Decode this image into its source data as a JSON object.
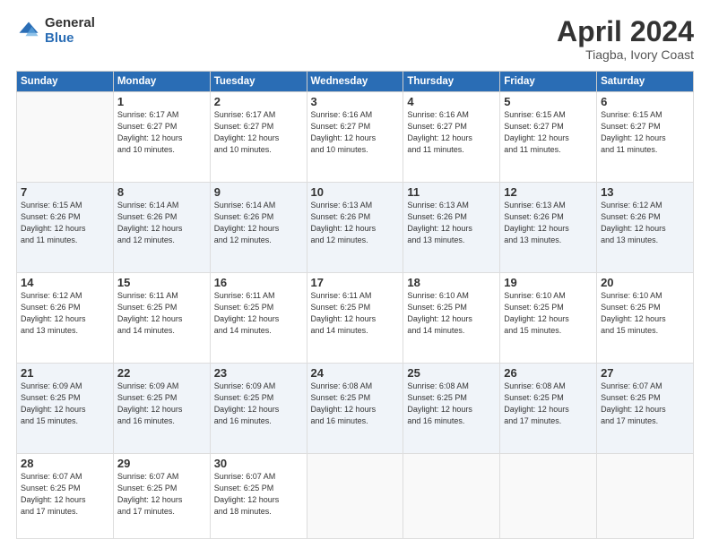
{
  "header": {
    "logo_general": "General",
    "logo_blue": "Blue",
    "month_title": "April 2024",
    "location": "Tiagba, Ivory Coast"
  },
  "days_of_week": [
    "Sunday",
    "Monday",
    "Tuesday",
    "Wednesday",
    "Thursday",
    "Friday",
    "Saturday"
  ],
  "weeks": [
    [
      {
        "day": "",
        "info": ""
      },
      {
        "day": "1",
        "info": "Sunrise: 6:17 AM\nSunset: 6:27 PM\nDaylight: 12 hours\nand 10 minutes."
      },
      {
        "day": "2",
        "info": "Sunrise: 6:17 AM\nSunset: 6:27 PM\nDaylight: 12 hours\nand 10 minutes."
      },
      {
        "day": "3",
        "info": "Sunrise: 6:16 AM\nSunset: 6:27 PM\nDaylight: 12 hours\nand 10 minutes."
      },
      {
        "day": "4",
        "info": "Sunrise: 6:16 AM\nSunset: 6:27 PM\nDaylight: 12 hours\nand 11 minutes."
      },
      {
        "day": "5",
        "info": "Sunrise: 6:15 AM\nSunset: 6:27 PM\nDaylight: 12 hours\nand 11 minutes."
      },
      {
        "day": "6",
        "info": "Sunrise: 6:15 AM\nSunset: 6:27 PM\nDaylight: 12 hours\nand 11 minutes."
      }
    ],
    [
      {
        "day": "7",
        "info": "Sunrise: 6:15 AM\nSunset: 6:26 PM\nDaylight: 12 hours\nand 11 minutes."
      },
      {
        "day": "8",
        "info": "Sunrise: 6:14 AM\nSunset: 6:26 PM\nDaylight: 12 hours\nand 12 minutes."
      },
      {
        "day": "9",
        "info": "Sunrise: 6:14 AM\nSunset: 6:26 PM\nDaylight: 12 hours\nand 12 minutes."
      },
      {
        "day": "10",
        "info": "Sunrise: 6:13 AM\nSunset: 6:26 PM\nDaylight: 12 hours\nand 12 minutes."
      },
      {
        "day": "11",
        "info": "Sunrise: 6:13 AM\nSunset: 6:26 PM\nDaylight: 12 hours\nand 13 minutes."
      },
      {
        "day": "12",
        "info": "Sunrise: 6:13 AM\nSunset: 6:26 PM\nDaylight: 12 hours\nand 13 minutes."
      },
      {
        "day": "13",
        "info": "Sunrise: 6:12 AM\nSunset: 6:26 PM\nDaylight: 12 hours\nand 13 minutes."
      }
    ],
    [
      {
        "day": "14",
        "info": "Sunrise: 6:12 AM\nSunset: 6:26 PM\nDaylight: 12 hours\nand 13 minutes."
      },
      {
        "day": "15",
        "info": "Sunrise: 6:11 AM\nSunset: 6:25 PM\nDaylight: 12 hours\nand 14 minutes."
      },
      {
        "day": "16",
        "info": "Sunrise: 6:11 AM\nSunset: 6:25 PM\nDaylight: 12 hours\nand 14 minutes."
      },
      {
        "day": "17",
        "info": "Sunrise: 6:11 AM\nSunset: 6:25 PM\nDaylight: 12 hours\nand 14 minutes."
      },
      {
        "day": "18",
        "info": "Sunrise: 6:10 AM\nSunset: 6:25 PM\nDaylight: 12 hours\nand 14 minutes."
      },
      {
        "day": "19",
        "info": "Sunrise: 6:10 AM\nSunset: 6:25 PM\nDaylight: 12 hours\nand 15 minutes."
      },
      {
        "day": "20",
        "info": "Sunrise: 6:10 AM\nSunset: 6:25 PM\nDaylight: 12 hours\nand 15 minutes."
      }
    ],
    [
      {
        "day": "21",
        "info": "Sunrise: 6:09 AM\nSunset: 6:25 PM\nDaylight: 12 hours\nand 15 minutes."
      },
      {
        "day": "22",
        "info": "Sunrise: 6:09 AM\nSunset: 6:25 PM\nDaylight: 12 hours\nand 16 minutes."
      },
      {
        "day": "23",
        "info": "Sunrise: 6:09 AM\nSunset: 6:25 PM\nDaylight: 12 hours\nand 16 minutes."
      },
      {
        "day": "24",
        "info": "Sunrise: 6:08 AM\nSunset: 6:25 PM\nDaylight: 12 hours\nand 16 minutes."
      },
      {
        "day": "25",
        "info": "Sunrise: 6:08 AM\nSunset: 6:25 PM\nDaylight: 12 hours\nand 16 minutes."
      },
      {
        "day": "26",
        "info": "Sunrise: 6:08 AM\nSunset: 6:25 PM\nDaylight: 12 hours\nand 17 minutes."
      },
      {
        "day": "27",
        "info": "Sunrise: 6:07 AM\nSunset: 6:25 PM\nDaylight: 12 hours\nand 17 minutes."
      }
    ],
    [
      {
        "day": "28",
        "info": "Sunrise: 6:07 AM\nSunset: 6:25 PM\nDaylight: 12 hours\nand 17 minutes."
      },
      {
        "day": "29",
        "info": "Sunrise: 6:07 AM\nSunset: 6:25 PM\nDaylight: 12 hours\nand 17 minutes."
      },
      {
        "day": "30",
        "info": "Sunrise: 6:07 AM\nSunset: 6:25 PM\nDaylight: 12 hours\nand 18 minutes."
      },
      {
        "day": "",
        "info": ""
      },
      {
        "day": "",
        "info": ""
      },
      {
        "day": "",
        "info": ""
      },
      {
        "day": "",
        "info": ""
      }
    ]
  ]
}
